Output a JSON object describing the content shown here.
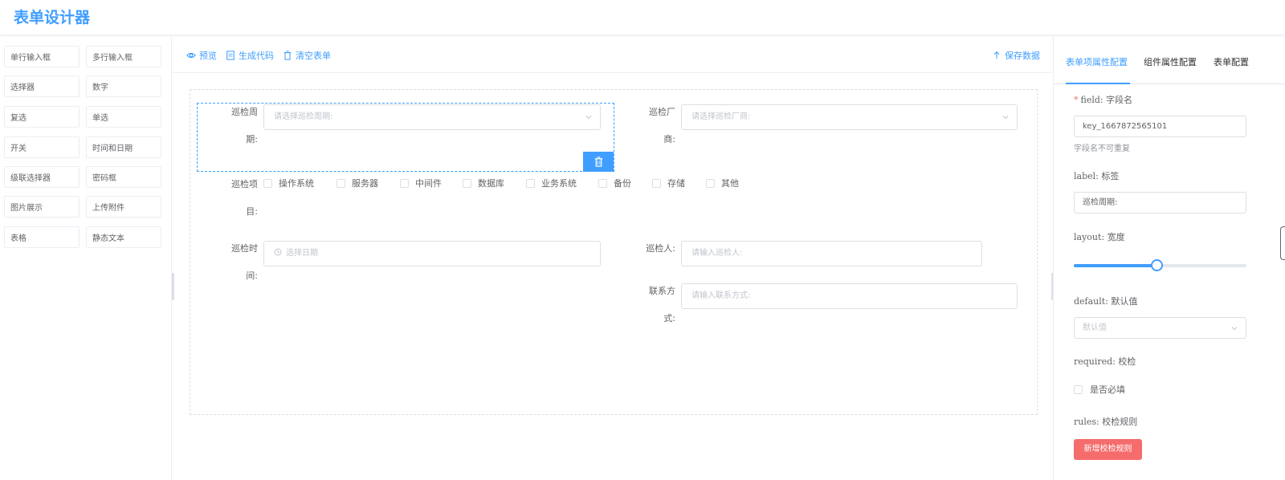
{
  "app": {
    "title": "表单设计器"
  },
  "components": [
    "单行输入框",
    "多行输入框",
    "选择器",
    "数字",
    "复选",
    "单选",
    "开关",
    "时间和日期",
    "级联选择器",
    "密码框",
    "图片展示",
    "上传附件",
    "表格",
    "静态文本"
  ],
  "toolbar": {
    "preview": "预览",
    "generate": "生成代码",
    "clear": "清空表单",
    "save": "保存数据"
  },
  "form": {
    "period_label_1": "巡检周",
    "period_label_2": "期:",
    "period_placeholder": "请选择巡检周期:",
    "vendor_label_1": "巡检厂",
    "vendor_label_2": "商:",
    "vendor_placeholder": "请选择巡检厂商:",
    "items_label_1": "巡检项",
    "items_label_2": "目:",
    "items_options": [
      "操作系统",
      "服务器",
      "中间件",
      "数据库",
      "业务系统",
      "备份",
      "存储",
      "其他"
    ],
    "time_label_1": "巡检时",
    "time_label_2": "间:",
    "time_placeholder": "选择日期",
    "inspector_label": "巡检人:",
    "inspector_placeholder": "请输入巡检人:",
    "contact_label_1": "联系方",
    "contact_label_2": "式:",
    "contact_placeholder": "请输入联系方式:"
  },
  "props": {
    "tabs": [
      "表单项属性配置",
      "组件属性配置",
      "表单配置"
    ],
    "active_tab": 0,
    "field_label": "field: 字段名",
    "field_value": "key_1667872565101",
    "field_hint": "字段名不可重复",
    "label_label": "label: 标签",
    "label_value": "巡检周期:",
    "layout_label": "layout: 宽度",
    "layout_fraction": 0.48,
    "default_label": "default: 默认值",
    "default_placeholder": "默认值",
    "required_label": "required: 校检",
    "required_checkbox": "是否必填",
    "rules_label": "rules: 校检规则",
    "add_rule_button": "新增校检规则"
  },
  "colors": {
    "primary": "#409eff",
    "danger": "#f56c6c",
    "border": "#dcdfe6"
  }
}
